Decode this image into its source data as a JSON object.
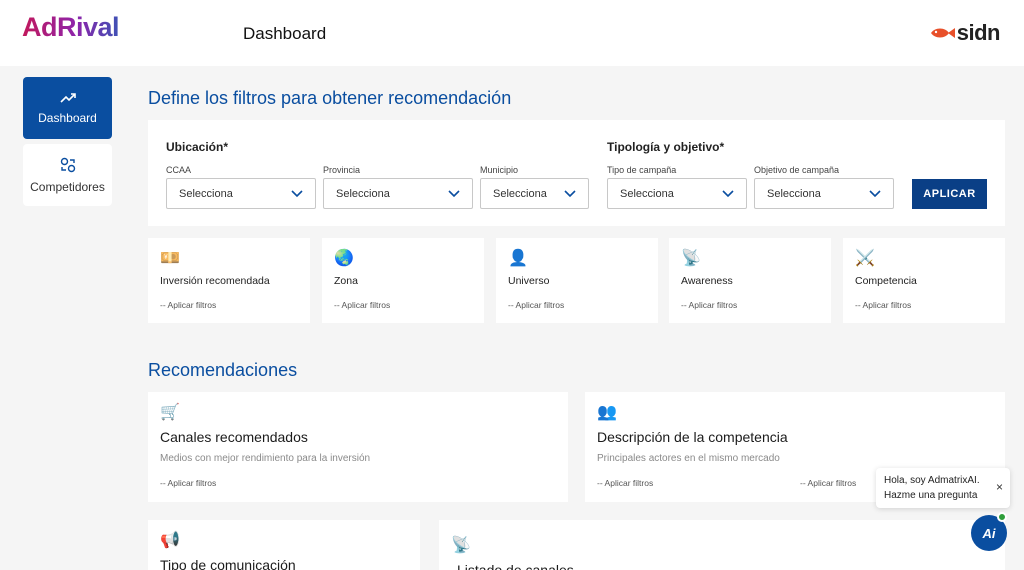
{
  "header": {
    "logo": "AdRival",
    "title": "Dashboard",
    "brand_right": "sidn"
  },
  "sidebar": {
    "items": [
      {
        "label": "Dashboard",
        "icon": "trending-up-icon",
        "active": true
      },
      {
        "label": "Competidores",
        "icon": "competitors-icon",
        "active": false
      }
    ]
  },
  "filters": {
    "title": "Define los filtros para obtener recomendación",
    "location_group": "Ubicación*",
    "type_group": "Tipología y objetivo*",
    "fields": [
      {
        "label": "CCAA",
        "value": "Selecciona"
      },
      {
        "label": "Provincia",
        "value": "Selecciona"
      },
      {
        "label": "Municipio",
        "value": "Selecciona"
      },
      {
        "label": "Tipo de campaña",
        "value": "Selecciona"
      },
      {
        "label": "Objetivo de campaña",
        "value": "Selecciona"
      }
    ],
    "apply": "APLICAR"
  },
  "metrics": [
    {
      "icon": "💴",
      "title": "Inversión recomendada",
      "value": "-- Aplicar filtros"
    },
    {
      "icon": "🌏",
      "title": "Zona",
      "value": "-- Aplicar filtros"
    },
    {
      "icon": "👤",
      "title": "Universo",
      "value": "-- Aplicar filtros"
    },
    {
      "icon": "📡",
      "title": "Awareness",
      "value": "-- Aplicar filtros"
    },
    {
      "icon": "⚔️",
      "title": "Competencia",
      "value": "-- Aplicar filtros"
    }
  ],
  "recommendations": {
    "title": "Recomendaciones",
    "cards": [
      {
        "icon": "🛒",
        "title": "Canales recomendados",
        "subtitle": "Medios con mejor rendimiento para la inversión",
        "status": "-- Aplicar filtros"
      },
      {
        "icon": "👥",
        "title": "Descripción de la competencia",
        "subtitle": "Principales actores en el mismo mercado",
        "status": "-- Aplicar filtros",
        "status2": "-- Aplicar filtros"
      },
      {
        "icon": "📢",
        "title": "Tipo de comunicación"
      },
      {
        "icon": "📡",
        "title": "Listado de canales"
      }
    ]
  },
  "chat": {
    "message": "Hola, soy AdmatrixAI. Hazme una pregunta",
    "close": "×",
    "avatar": "Ai"
  },
  "colors": {
    "primary": "#0a4ea0",
    "button": "#0a3f86",
    "background": "#f5f5f5"
  }
}
